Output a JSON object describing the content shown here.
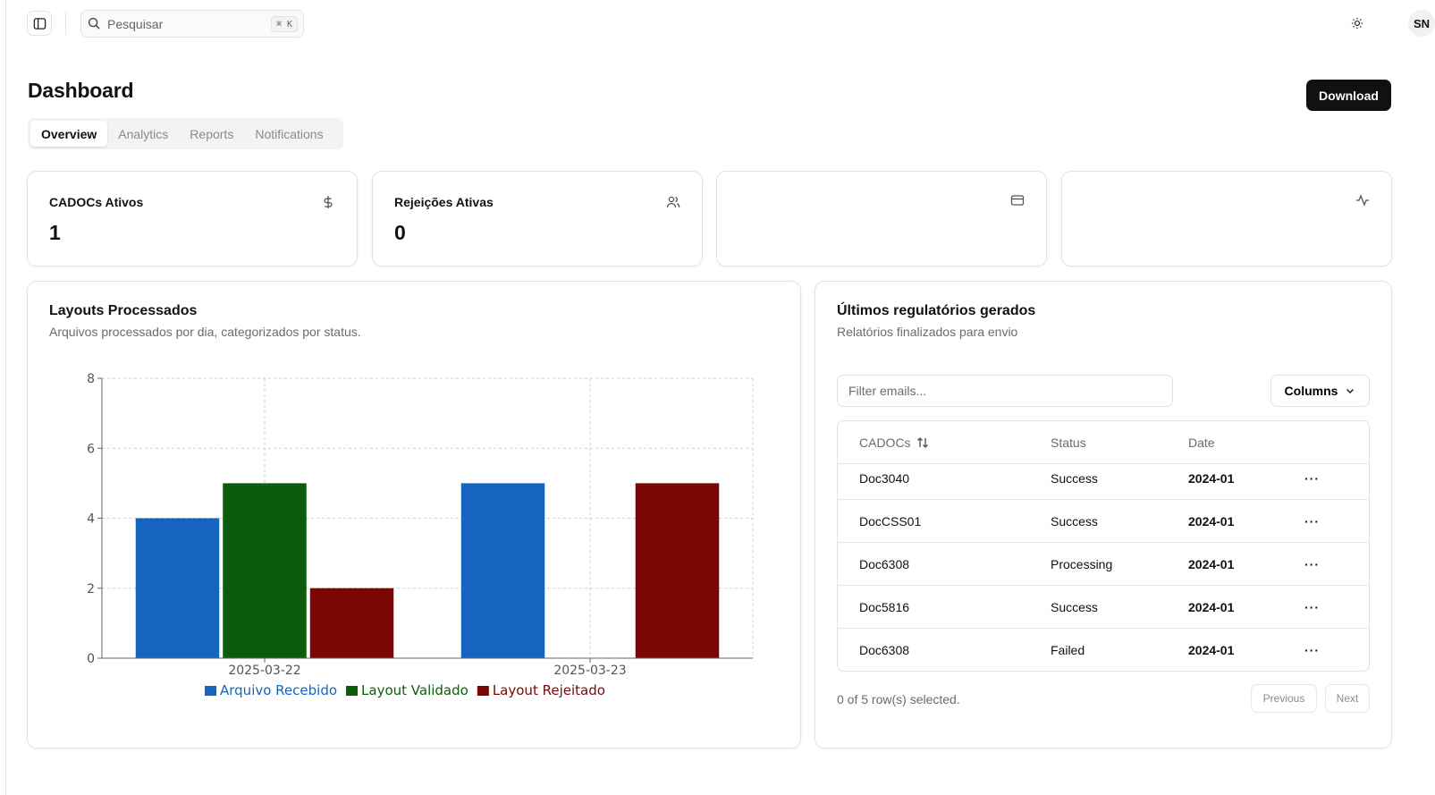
{
  "header": {
    "search_placeholder": "Pesquisar",
    "search_shortcut": "⌘ K",
    "avatar_initials": "SN"
  },
  "page": {
    "title": "Dashboard",
    "download_label": "Download"
  },
  "tabs": [
    {
      "label": "Overview",
      "active": true
    },
    {
      "label": "Analytics",
      "active": false
    },
    {
      "label": "Reports",
      "active": false
    },
    {
      "label": "Notifications",
      "active": false
    }
  ],
  "stats": [
    {
      "label": "CADOCs Ativos",
      "value": "1",
      "icon": "dollar-sign-icon"
    },
    {
      "label": "Rejeições Ativas",
      "value": "0",
      "icon": "users-icon"
    },
    {
      "label": "",
      "value": "",
      "icon": "credit-card-icon"
    },
    {
      "label": "",
      "value": "",
      "icon": "activity-icon"
    }
  ],
  "chart_card": {
    "title": "Layouts Processados",
    "subtitle": "Arquivos processados por dia, categorizados por status."
  },
  "chart_data": {
    "type": "bar",
    "categories": [
      "2025-03-22",
      "2025-03-23"
    ],
    "series": [
      {
        "name": "Arquivo Recebido",
        "values": [
          4,
          5
        ],
        "color": "#1565c0"
      },
      {
        "name": "Layout Validado",
        "values": [
          5,
          0
        ],
        "color": "#0d5c0d"
      },
      {
        "name": "Layout Rejeitado",
        "values": [
          2,
          5
        ],
        "color": "#7a0606"
      }
    ],
    "yticks": [
      0,
      2,
      4,
      6,
      8
    ],
    "ylim": [
      0,
      8
    ],
    "grid": true,
    "legend_position": "bottom"
  },
  "table_card": {
    "title": "Últimos regulatórios gerados",
    "subtitle": "Relatórios finalizados para envio",
    "filter_placeholder": "Filter emails...",
    "columns_label": "Columns",
    "headers": {
      "cadocs": "CADOCs",
      "status": "Status",
      "date": "Date"
    },
    "rows": [
      {
        "cadocs": "Doc3040",
        "status": "Success",
        "date": "2024-01",
        "actions": "···"
      },
      {
        "cadocs": "DocCSS01",
        "status": "Success",
        "date": "2024-01",
        "actions": "···"
      },
      {
        "cadocs": "Doc6308",
        "status": "Processing",
        "date": "2024-01",
        "actions": "···"
      },
      {
        "cadocs": "Doc5816",
        "status": "Success",
        "date": "2024-01",
        "actions": "···"
      },
      {
        "cadocs": "Doc6308",
        "status": "Failed",
        "date": "2024-01",
        "actions": "···"
      }
    ],
    "selection_text": "0 of 5 row(s) selected.",
    "previous_label": "Previous",
    "next_label": "Next"
  }
}
